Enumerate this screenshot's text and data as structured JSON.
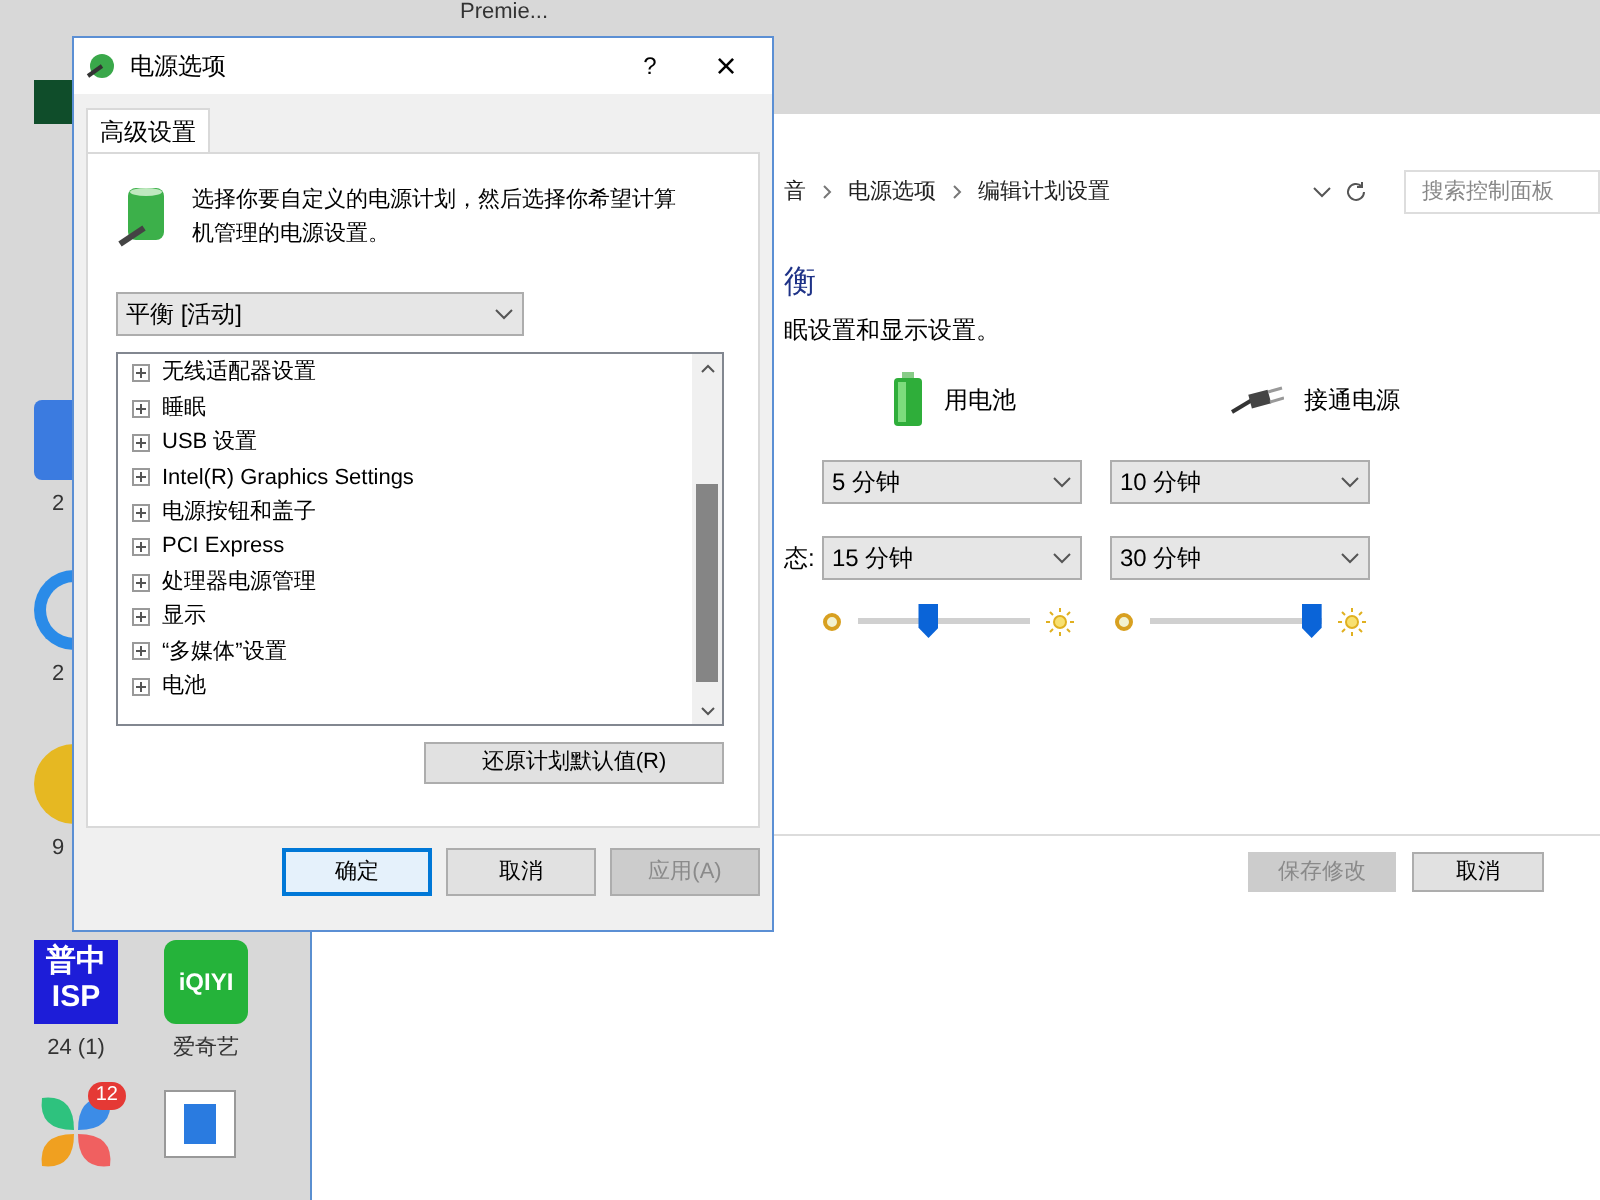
{
  "desktop": {
    "icons": [
      {
        "kind": "top",
        "label": "Premie..."
      },
      {
        "kind": "green"
      },
      {
        "kind": "yc",
        "label": "2"
      },
      {
        "kind": "ring",
        "label": "2"
      },
      {
        "kind": "ball",
        "label": "9"
      },
      {
        "kind": "isp",
        "logo": "普中ISP",
        "label": "24 (1)"
      },
      {
        "kind": "iqiyi",
        "logo": "iQIYI",
        "label": "爱奇艺"
      },
      {
        "kind": "flower",
        "badge": "12"
      },
      {
        "kind": "window"
      }
    ]
  },
  "control_panel": {
    "breadcrumb": [
      "音",
      "电源选项",
      "编辑计划设置"
    ],
    "search": {
      "placeholder": "搜索控制面板"
    },
    "heading": "衡",
    "description": "眠设置和显示设置。",
    "columns": [
      {
        "kind": "battery",
        "label": "用电池"
      },
      {
        "kind": "plug",
        "label": "接通电源"
      }
    ],
    "rows": [
      {
        "values": [
          "5 分钟",
          "10 分钟"
        ]
      },
      {
        "label": "态:",
        "values": [
          "15 分钟",
          "30 分钟"
        ]
      }
    ],
    "brightness": [
      {
        "level": 0.41
      },
      {
        "level": 0.94
      }
    ],
    "buttons": [
      {
        "label": "保存修改",
        "disabled": true
      },
      {
        "label": "取消",
        "disabled": false
      }
    ]
  },
  "dialog": {
    "title": "电源选项",
    "help": "?",
    "close": "×",
    "tabs": [
      {
        "label": "高级设置",
        "selected": true
      }
    ],
    "intro": "选择你要自定义的电源计划，然后选择你希望计算机管理的电源设置。",
    "plan": "平衡 [活动]",
    "tree": [
      {
        "label": "无线适配器设置",
        "expanded": false
      },
      {
        "label": "睡眠",
        "expanded": false
      },
      {
        "label": "USB 设置",
        "expanded": false
      },
      {
        "label": "Intel(R) Graphics Settings",
        "expanded": false
      },
      {
        "label": "电源按钮和盖子",
        "expanded": false
      },
      {
        "label": "PCI Express",
        "expanded": false
      },
      {
        "label": "处理器电源管理",
        "expanded": false
      },
      {
        "label": "显示",
        "expanded": false
      },
      {
        "label": "“多媒体”设置",
        "expanded": false
      },
      {
        "label": "电池",
        "expanded": false
      }
    ],
    "restore": "还原计划默认值(R)",
    "buttons": [
      {
        "label": "确定",
        "focused": true,
        "disabled": false
      },
      {
        "label": "取消",
        "focused": false,
        "disabled": false
      },
      {
        "label": "应用(A)",
        "focused": false,
        "disabled": true
      }
    ]
  }
}
